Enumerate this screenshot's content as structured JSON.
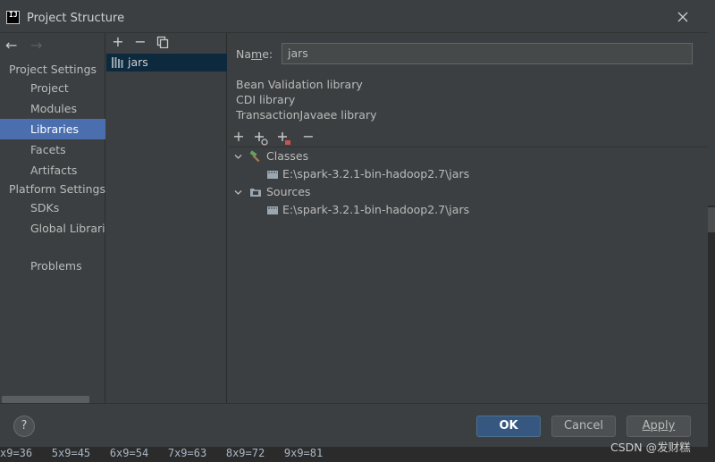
{
  "window": {
    "title": "Project Structure"
  },
  "nav": {
    "project_settings": "Project Settings",
    "project_items": [
      "Project",
      "Modules",
      "Libraries",
      "Facets",
      "Artifacts"
    ],
    "platform_settings": "Platform Settings",
    "platform_items": [
      "SDKs",
      "Global Libraries"
    ],
    "problems": "Problems",
    "selected": "Libraries"
  },
  "library_list": {
    "items": [
      {
        "label": "jars",
        "selected": true
      }
    ]
  },
  "details": {
    "name_label_pre": "Na",
    "name_label_mnemonic": "m",
    "name_label_post": "e:",
    "name_value": "jars",
    "library_kinds": [
      "Bean Validation library",
      "CDI library",
      "TransactionJavaee library"
    ],
    "tree": {
      "classes_label": "Classes",
      "classes_path": "E:\\spark-3.2.1-bin-hadoop2.7\\jars",
      "sources_label": "Sources",
      "sources_path": "E:\\spark-3.2.1-bin-hadoop2.7\\jars"
    }
  },
  "footer": {
    "help": "?",
    "ok": "OK",
    "cancel": "Cancel",
    "apply": "Apply"
  },
  "console": {
    "text": "x9=36   5x9=45   6x9=54   7x9=63   8x9=72   9x9=81"
  },
  "watermark": "CSDN @发财糕",
  "colors": {
    "selection": "#4b6eaf",
    "list_selection": "#0d293e",
    "ok_button": "#365880",
    "background": "#3c3f41"
  }
}
